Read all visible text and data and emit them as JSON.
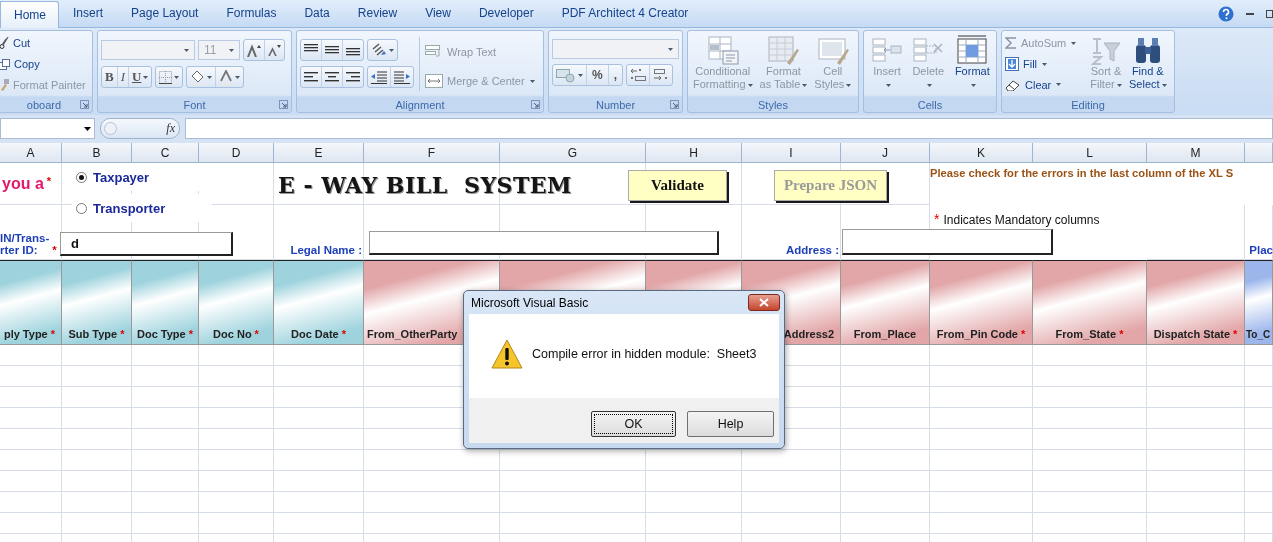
{
  "tabs": [
    {
      "label": "Home",
      "selected": true
    },
    {
      "label": "Insert",
      "selected": false
    },
    {
      "label": "Page Layout",
      "selected": false
    },
    {
      "label": "Formulas",
      "selected": false
    },
    {
      "label": "Data",
      "selected": false
    },
    {
      "label": "Review",
      "selected": false
    },
    {
      "label": "View",
      "selected": false
    },
    {
      "label": "Developer",
      "selected": false
    },
    {
      "label": "PDF Architect 4 Creator",
      "selected": false
    }
  ],
  "ribbon": {
    "groups": [
      {
        "kind": "clipboard",
        "label": "oboard",
        "commands": [
          {
            "label": "Cut",
            "disabled": false,
            "menu": false
          },
          {
            "label": "Copy",
            "disabled": false,
            "menu": false
          },
          {
            "label": "Format Painter",
            "disabled": true,
            "menu": false
          }
        ]
      },
      {
        "kind": "font",
        "label": "Font",
        "font_size": "11",
        "style_buttons": [
          "B",
          "I",
          "U"
        ]
      },
      {
        "kind": "alignment",
        "label": "Alignment",
        "commands": [
          {
            "label": "Wrap Text",
            "disabled": true,
            "menu": false
          },
          {
            "label": "Merge & Center",
            "disabled": true,
            "menu": true
          }
        ]
      },
      {
        "kind": "number",
        "label": "Number",
        "symbols": [
          "%",
          ","
        ]
      },
      {
        "kind": "styles",
        "label": "Styles",
        "commands": [
          {
            "label": "Conditional\nFormatting",
            "disabled": true,
            "menu": true
          },
          {
            "label": "Format\nas Table",
            "disabled": true,
            "menu": true
          },
          {
            "label": "Cell\nStyles",
            "disabled": true,
            "menu": true
          }
        ]
      },
      {
        "kind": "cells",
        "label": "Cells",
        "commands": [
          {
            "label": "Insert",
            "disabled": true,
            "menu": true
          },
          {
            "label": "Delete",
            "disabled": true,
            "menu": true
          },
          {
            "label": "Format",
            "disabled": false,
            "menu": true
          }
        ]
      },
      {
        "kind": "editing",
        "label": "Editing",
        "commands": [
          {
            "label": "AutoSum",
            "disabled": true,
            "menu": true
          },
          {
            "label": "Fill",
            "disabled": false,
            "menu": true
          },
          {
            "label": "Clear",
            "disabled": false,
            "menu": true
          },
          {
            "label": "Sort &\nFilter",
            "disabled": true,
            "menu": true
          },
          {
            "label": "Find &\nSelect",
            "disabled": false,
            "menu": true
          }
        ]
      }
    ]
  },
  "formula_bar": {
    "fx_label": "fx"
  },
  "columns": [
    "A",
    "B",
    "C",
    "D",
    "E",
    "F",
    "G",
    "H",
    "I",
    "J",
    "K",
    "L",
    "M"
  ],
  "sheet": {
    "prompt": {
      "text": "you a",
      "mark": "*"
    },
    "party_options": [
      {
        "label": "Taxpayer",
        "selected": true
      },
      {
        "label": "Transporter",
        "selected": false
      }
    ],
    "title": "E - WAY BILL  SYSTEM",
    "buttons": [
      {
        "label": "Validate",
        "disabled": false
      },
      {
        "label": "Prepare JSON",
        "disabled": true
      }
    ],
    "error_note": "Please check for the errors in the last column of the XL S",
    "mandatory_note": {
      "mark": "*",
      "text": "Indicates Mandatory columns"
    },
    "fields": [
      {
        "kind": "id",
        "label": "IN/Trans-\nrter ID:",
        "mark": "*",
        "value": "d"
      },
      {
        "kind": "legal_name",
        "label": "Legal Name :"
      },
      {
        "kind": "address",
        "label": "Address :"
      }
    ],
    "place_label": "Plac",
    "header_cells": [
      {
        "label": "ply Type",
        "mark": "*",
        "color": "#9ed3dd"
      },
      {
        "label": "Sub Type",
        "mark": "*",
        "color": "#9ed3dd"
      },
      {
        "label": "Doc Type",
        "mark": "*",
        "color": "#9ed3dd"
      },
      {
        "label": "Doc No",
        "mark": "*",
        "color": "#9ed3dd"
      },
      {
        "label": "Doc Date",
        "mark": "*",
        "color": "#9ed3dd"
      },
      {
        "label": "From_OtherParty",
        "color": "#e2a6a8"
      },
      {
        "color": "#e2a6a8"
      },
      {
        "color": "#e2a6a8"
      },
      {
        "label": "Address2",
        "color": "#e2a6a8"
      },
      {
        "label": "From_Place",
        "color": "#e2a6a8"
      },
      {
        "label": "From_Pin Code",
        "mark": "*",
        "color": "#e2a6a8"
      },
      {
        "label": "From_State",
        "mark": "*",
        "color": "#e2a6a8"
      },
      {
        "label": "Dispatch State",
        "mark": "*",
        "color": "#e2a6a8"
      },
      {
        "label": "To_C",
        "color": "#9cb6ec"
      }
    ]
  },
  "dialog": {
    "title": "Microsoft Visual Basic",
    "message": "Compile error in hidden module:  Sheet3",
    "buttons": [
      {
        "label": "OK",
        "focused": true
      },
      {
        "label": "Help",
        "focused": false
      }
    ]
  }
}
